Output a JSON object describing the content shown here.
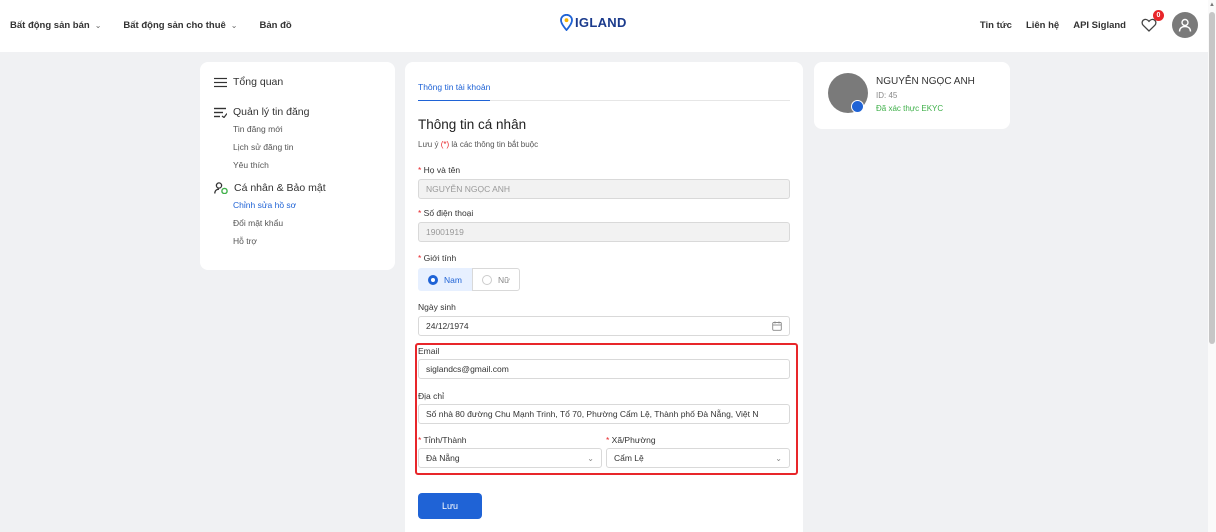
{
  "header": {
    "nav_left": [
      "Bất động sản bán",
      "Bất động sản cho thuê",
      "Bản đồ"
    ],
    "logo_text": "IGLAND",
    "nav_right": [
      "Tin tức",
      "Liên hệ",
      "API Sigland"
    ],
    "favorites_count": "0",
    "brand_color": "#1f63d6"
  },
  "sidebar": {
    "overview": "Tổng quan",
    "listings_group": "Quản lý tin đăng",
    "listings_items": [
      "Tin đăng mới",
      "Lịch sử đăng tin",
      "Yêu thích"
    ],
    "personal_group": "Cá nhân & Bảo mật",
    "personal_items": [
      "Chỉnh sửa hồ sơ",
      "Đổi mật khẩu",
      "Hỗ trợ"
    ]
  },
  "form": {
    "tab": "Thông tin tài khoản",
    "title": "Thông tin cá nhân",
    "note_prefix": "Lưu ý",
    "note_req": "(*)",
    "note_suffix": "là các thông tin bắt buộc",
    "name_label": "Họ và tên",
    "name_value": "NGUYỄN NGỌC ANH",
    "phone_label": "Số điện thoại",
    "phone_value": "19001919",
    "gender_label": "Giới tính",
    "gender_male": "Nam",
    "gender_female": "Nữ",
    "dob_label": "Ngày sinh",
    "dob_value": "24/12/1974",
    "email_label": "Email",
    "email_value": "siglandcs@gmail.com",
    "address_label": "Địa chỉ",
    "address_value": "Số nhà 80 đường Chu Mạnh Trinh, Tổ 70, Phường Cẩm Lệ, Thành phố Đà Nẵng, Việt N",
    "province_label": "Tỉnh/Thành",
    "province_value": "Đà Nẵng",
    "ward_label": "Xã/Phường",
    "ward_value": "Cẩm Lệ",
    "save_label": "Lưu"
  },
  "profile": {
    "name": "NGUYỄN NGỌC ANH",
    "id": "ID: 45",
    "verified": "Đã xác thực EKYC"
  }
}
